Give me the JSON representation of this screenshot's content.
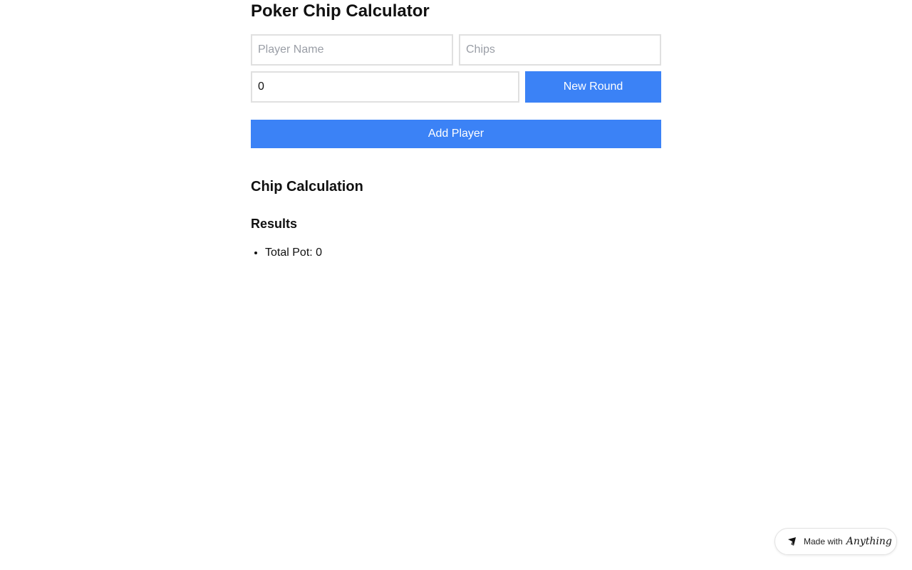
{
  "page": {
    "title": "Poker Chip Calculator"
  },
  "form": {
    "player_name_placeholder": "Player Name",
    "chips_placeholder": "Chips",
    "round_value": "0",
    "new_round_label": "New Round",
    "add_player_label": "Add Player"
  },
  "calculation": {
    "title": "Chip Calculation"
  },
  "results": {
    "title": "Results",
    "items": [
      {
        "label": "Total Pot: 0"
      }
    ]
  },
  "badge": {
    "prefix": "Made with",
    "brand": "Anything",
    "icon": "anything-logo-icon"
  },
  "colors": {
    "accent": "#3b82f6"
  }
}
